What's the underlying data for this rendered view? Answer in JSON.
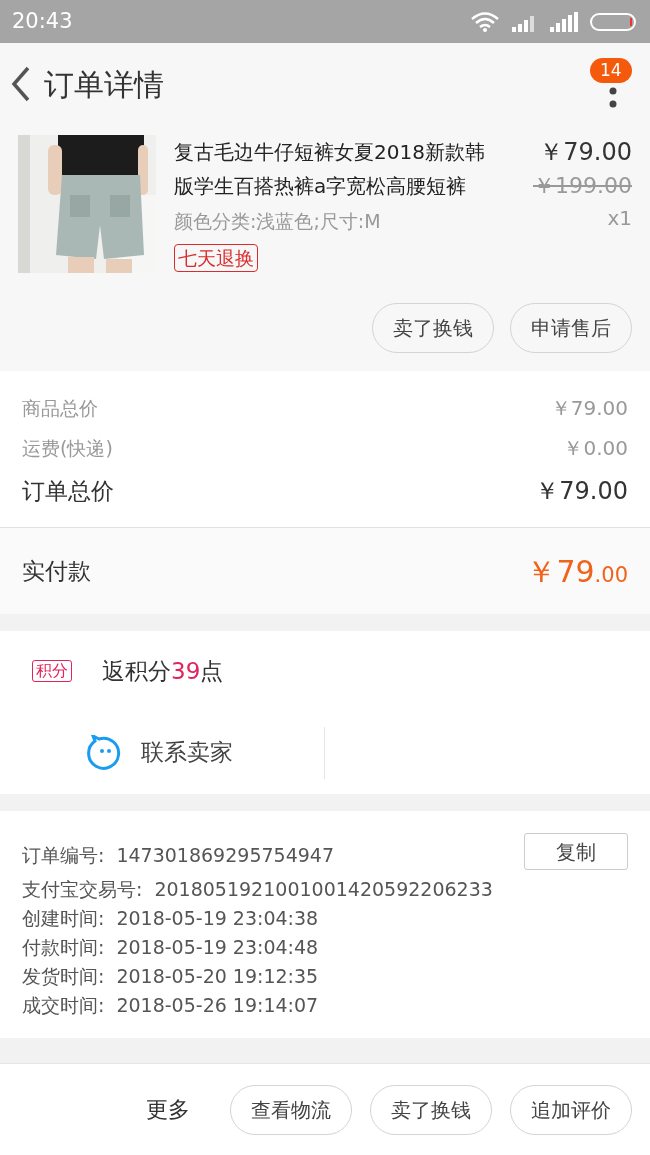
{
  "status_bar": {
    "time": "20:43"
  },
  "header": {
    "title": "订单详情",
    "badge": "14"
  },
  "product": {
    "title": "复古毛边牛仔短裤女夏2018新款韩版学生百搭热裤a字宽松高腰短裤",
    "sku": "颜色分类:浅蓝色;尺寸:M",
    "tag": "七天退换",
    "price": "￥79.00",
    "original_price": "￥199.00",
    "quantity": "x1"
  },
  "product_actions": [
    "卖了换钱",
    "申请售后"
  ],
  "summary": [
    {
      "label": "商品总价",
      "value": "￥79.00",
      "kind": "minor"
    },
    {
      "label": "运费(快递)",
      "value": "￥0.00",
      "kind": "minor"
    },
    {
      "label": "订单总价",
      "value": "￥79.00",
      "kind": "major"
    }
  ],
  "payment": {
    "label": "实付款",
    "amount_main": "￥79",
    "amount_decimal": ".00"
  },
  "points": {
    "tag": "积分",
    "prefix": "返积分",
    "value": "39",
    "suffix": "点"
  },
  "contact": {
    "label": "联系卖家"
  },
  "order_info": {
    "copy_button": "复制",
    "rows": [
      {
        "label": "订单编号:",
        "value": "147301869295754947"
      },
      {
        "label": "支付宝交易号:",
        "value": "2018051921001001420592206233"
      },
      {
        "label": "创建时间:",
        "value": "2018-05-19 23:04:38"
      },
      {
        "label": "付款时间:",
        "value": "2018-05-19 23:04:48"
      },
      {
        "label": "发货时间:",
        "value": "2018-05-20 19:12:35"
      },
      {
        "label": "成交时间:",
        "value": "2018-05-26 19:14:07"
      }
    ]
  },
  "bottom_bar": {
    "more": "更多",
    "buttons": [
      "查看物流",
      "卖了换钱",
      "追加评价"
    ]
  }
}
